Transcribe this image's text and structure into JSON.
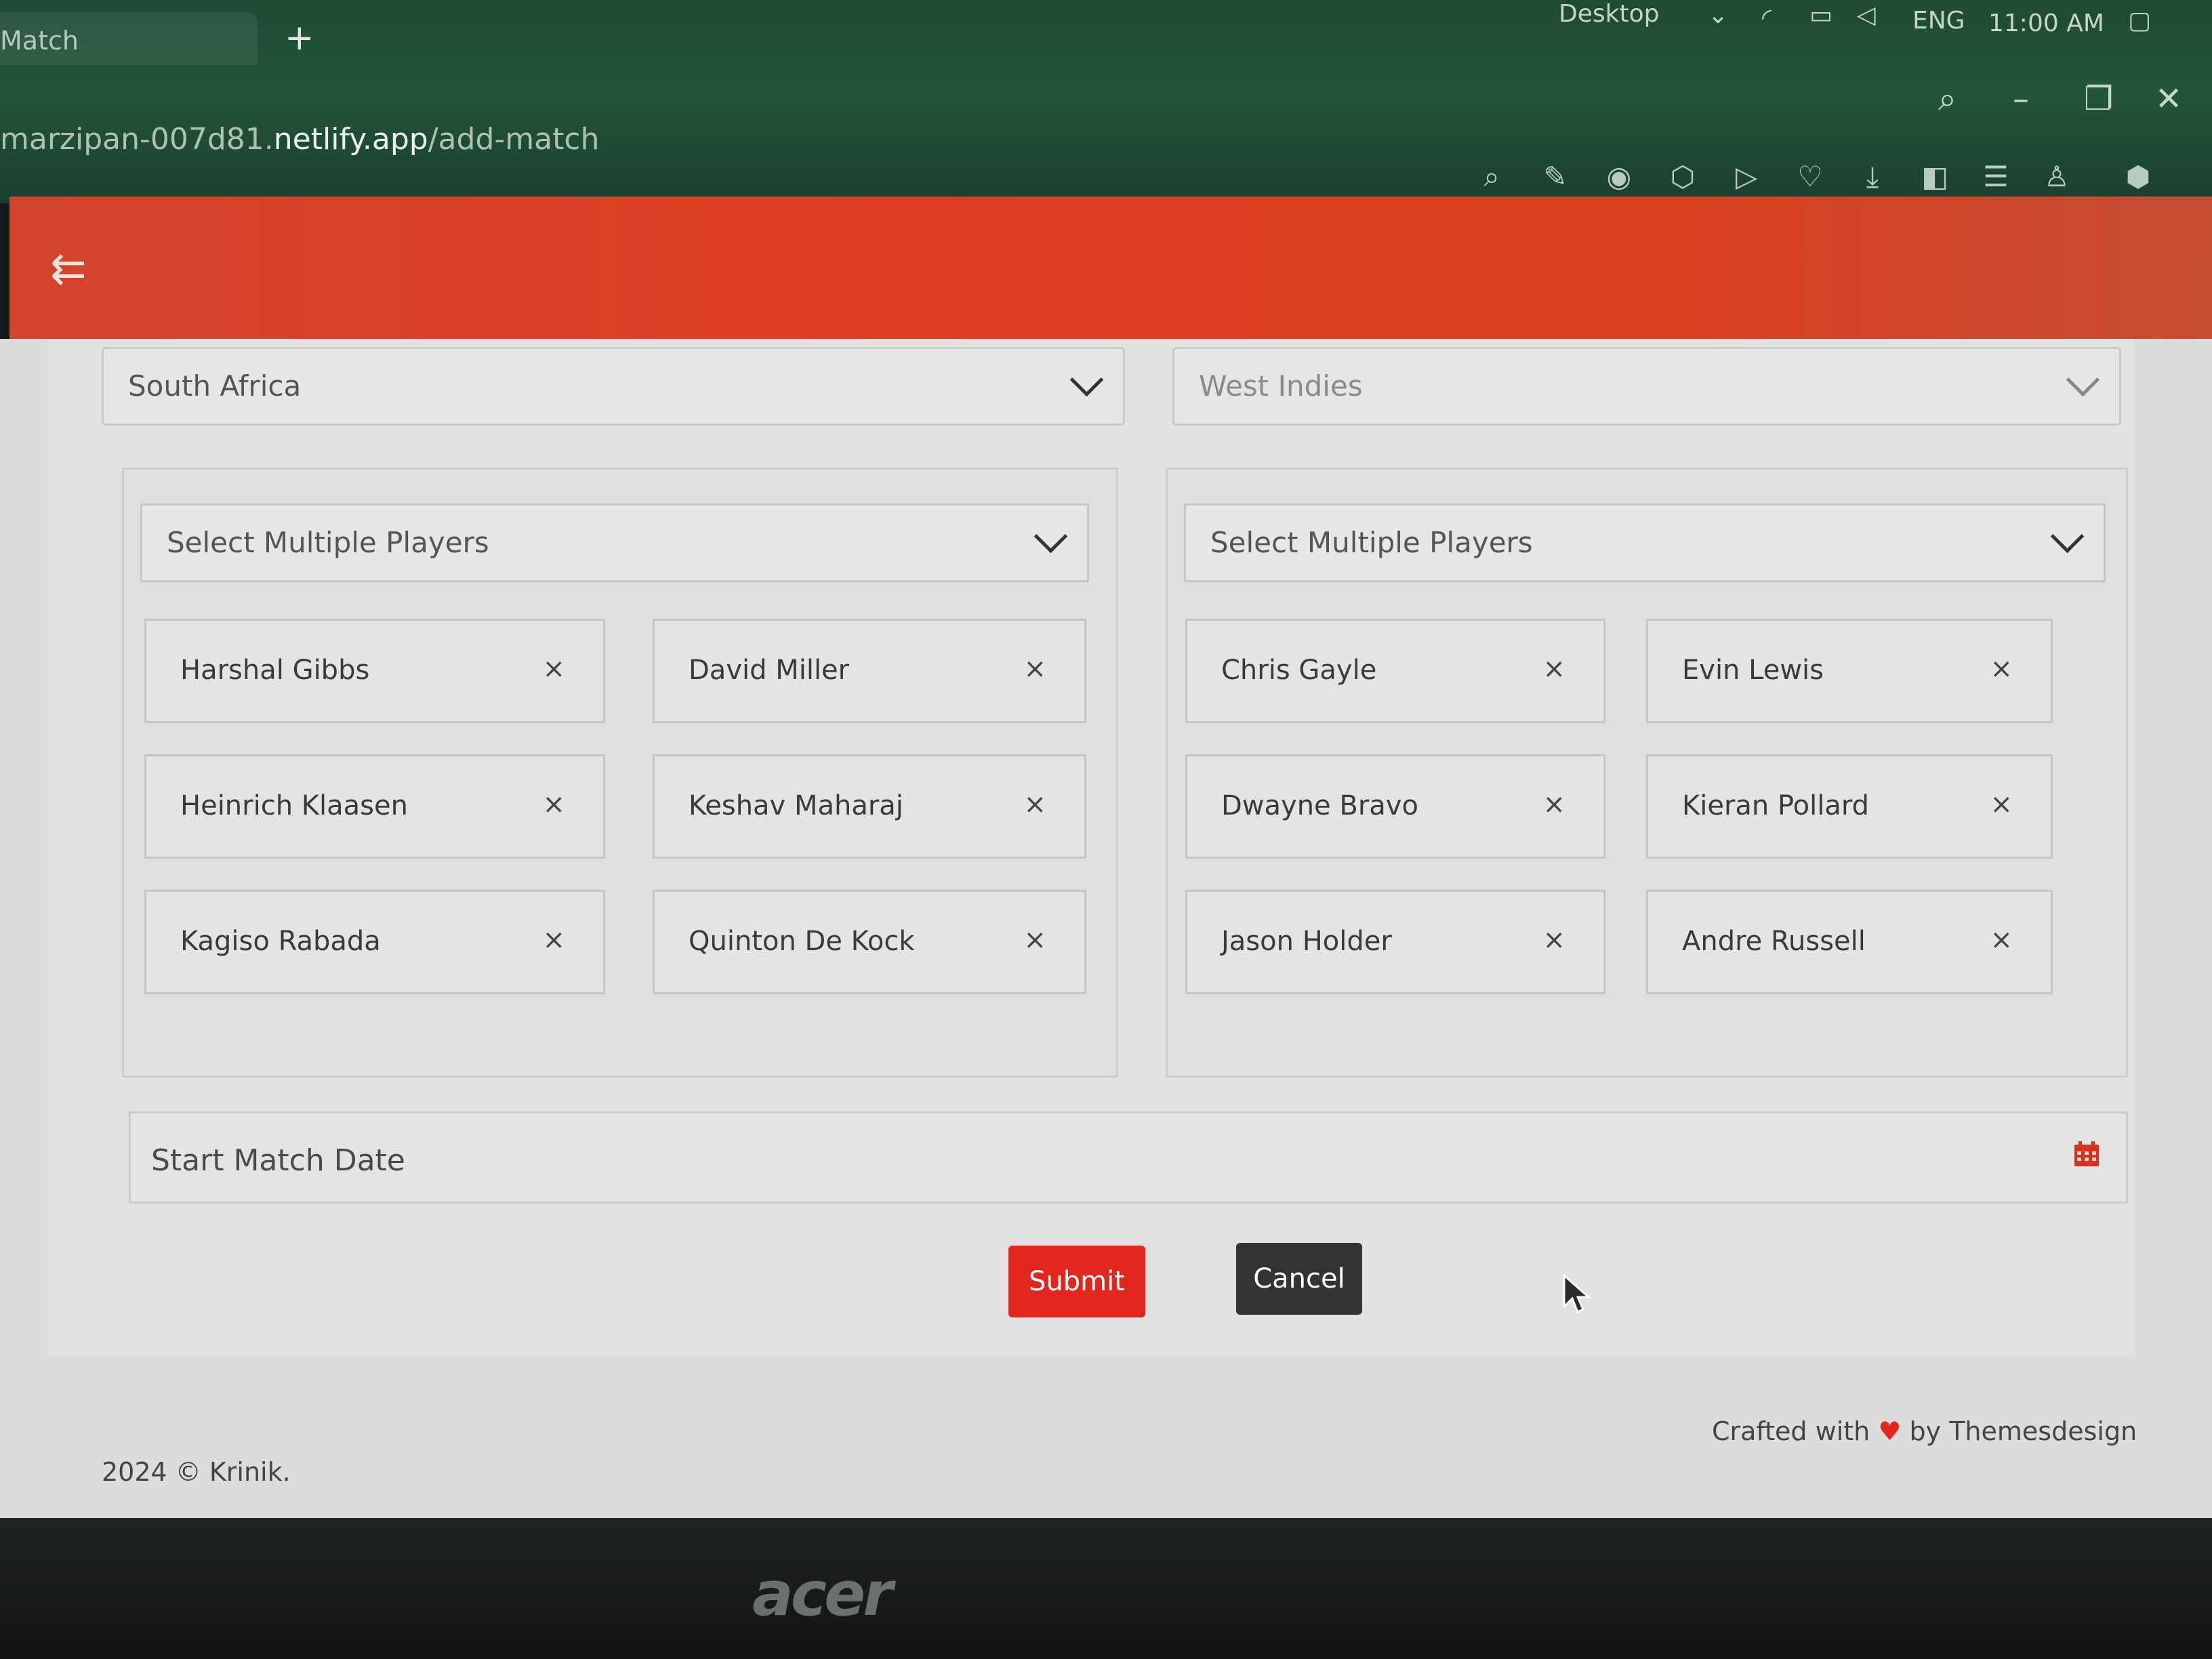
{
  "browser": {
    "tab_title": "Match",
    "new_tab": "+",
    "url_prefix": "marzipan-007d81.",
    "url_host": "netlify.app",
    "url_path": "/add-match",
    "tray_desktop": "Desktop",
    "tray_lang": "ENG",
    "tray_time": "11:00 AM"
  },
  "form": {
    "team_a": "South Africa",
    "team_b": "West Indies",
    "players_placeholder_a": "Select Multiple Players",
    "players_placeholder_b": "Select Multiple Players",
    "team_a_players": [
      "Harshal Gibbs",
      "David Miller",
      "Heinrich Klaasen",
      "Keshav Maharaj",
      "Kagiso Rabada",
      "Quinton De Kock"
    ],
    "team_b_players": [
      "Chris Gayle",
      "Evin Lewis",
      "Dwayne Bravo",
      "Kieran Pollard",
      "Jason Holder",
      "Andre Russell"
    ],
    "remove_symbol": "×",
    "date_placeholder": "Start Match Date",
    "submit_label": "Submit",
    "cancel_label": "Cancel"
  },
  "footer": {
    "copyright": "2024 © Krinik.",
    "crafted_prefix": "Crafted with",
    "crafted_heart": "♥",
    "crafted_suffix": "by Themesdesign"
  },
  "laptop": {
    "brand": "acer"
  },
  "colors": {
    "header_gradient": "#e03d22",
    "submit": "#e0261d",
    "cancel": "#333333",
    "calendar_icon": "#d9301f"
  }
}
